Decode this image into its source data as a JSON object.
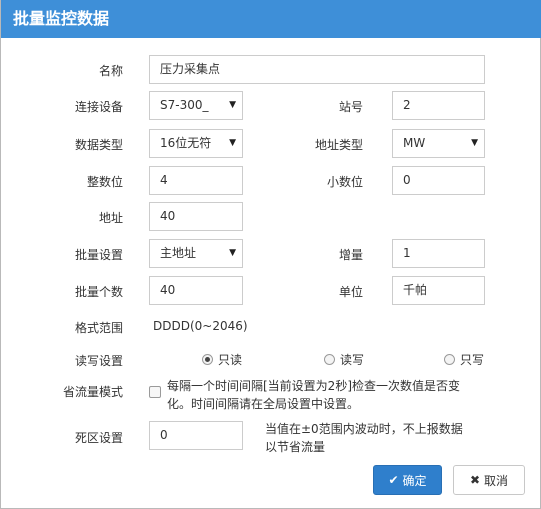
{
  "dialog": {
    "title": "批量监控数据",
    "fields": {
      "name": {
        "label": "名称",
        "value": "压力采集点"
      },
      "device": {
        "label": "连接设备",
        "value": "S7-300_"
      },
      "station": {
        "label": "站号",
        "value": "2"
      },
      "data_type": {
        "label": "数据类型",
        "value": "16位无符"
      },
      "address_type": {
        "label": "地址类型",
        "value": "MW"
      },
      "int_digits": {
        "label": "整数位",
        "value": "4"
      },
      "dec_digits": {
        "label": "小数位",
        "value": "0"
      },
      "address": {
        "label": "地址",
        "value": "40"
      },
      "batch_setting": {
        "label": "批量设置",
        "value": "主地址"
      },
      "increment": {
        "label": "增量",
        "value": "1"
      },
      "batch_count": {
        "label": "批量个数",
        "value": "40"
      },
      "unit": {
        "label": "单位",
        "value": "千帕"
      },
      "format_range": {
        "label": "格式范围",
        "value": "DDDD(0~2046)"
      },
      "rw": {
        "label": "读写设置",
        "options": [
          "只读",
          "读写",
          "只写"
        ],
        "selected": "只读"
      },
      "save_mode": {
        "label": "省流量模式",
        "line1": "每隔一个时间间隔[当前设置为2秒]检查一次数值是否变",
        "line2": "化。时间间隔请在全局设置中设置。",
        "checked": false
      },
      "deadband": {
        "label": "死区设置",
        "value": "0",
        "line1": "当值在±0范围内波动时，不上报数据",
        "line2": "以节省流量"
      }
    },
    "buttons": {
      "ok": "确定",
      "cancel": "取消"
    },
    "colors": {
      "header": "#3e8fd8",
      "primary": "#2f7fcc"
    }
  }
}
